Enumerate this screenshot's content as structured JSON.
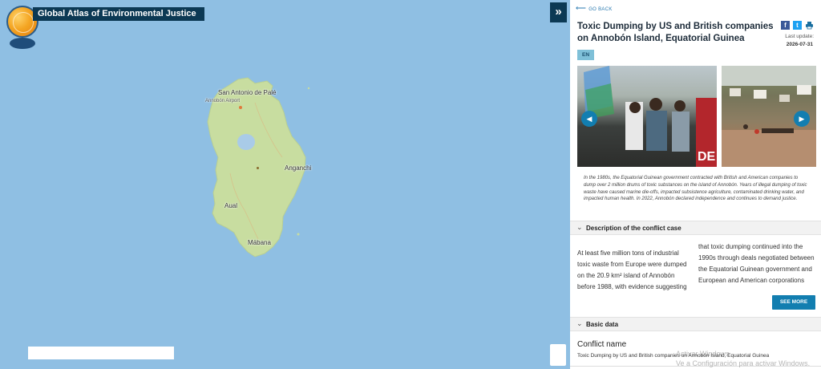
{
  "app": {
    "title": "Global Atlas of Environmental Justice",
    "collapse_icon": "double-chevron-right-icon"
  },
  "map": {
    "labels": {
      "san_antonio": "San Antonio de Palé",
      "airport": "Annobón Airport",
      "anganchi": "Anganchi",
      "aual": "Aual",
      "mabana": "Mábana"
    },
    "colors": {
      "water": "#8fbfe3",
      "land": "#c8dda0",
      "lake": "#a9cbe8"
    }
  },
  "panel": {
    "go_back": "GO BACK",
    "title": "Toxic Dumping by US and British companies on Annobón Island, Equatorial Guinea",
    "share": {
      "facebook": "f",
      "twitter": "t",
      "print_icon": "print-icon"
    },
    "last_update_label": "Last update:",
    "last_update_date": "2026-07-31",
    "language": "EN",
    "caption": "In the 1980s, the Equatorial Guinean government contracted with British and American companies to dump over 2 million drums of toxic substances on the island of Annobón. Years of illegal dumping of toxic waste have caused marine die-offs, impacted subsistence agriculture, contaminated drinking water, and impacted human health. In 2022, Annobón declared independence and continues to demand justice.",
    "description_header": "Description of the conflict case",
    "description_col1": "At least five million tons of industrial toxic waste from Europe were dumped on the 20.9 km² island of Annobón before 1988, with evidence suggesting",
    "description_col2": "that toxic dumping continued into the 1990s through deals negotiated between the Equatorial Guinean government and European and American corporations",
    "see_more": "SEE MORE",
    "basic_data_header": "Basic data",
    "conflict_name_label": "Conflict name",
    "conflict_name_value": "Toxic Dumping by US and British companies on Annobón Island, Equatorial Guinea"
  },
  "watermark": {
    "line1": "Activar Windows",
    "line2": "Ve a Configuración para activar Windows."
  }
}
